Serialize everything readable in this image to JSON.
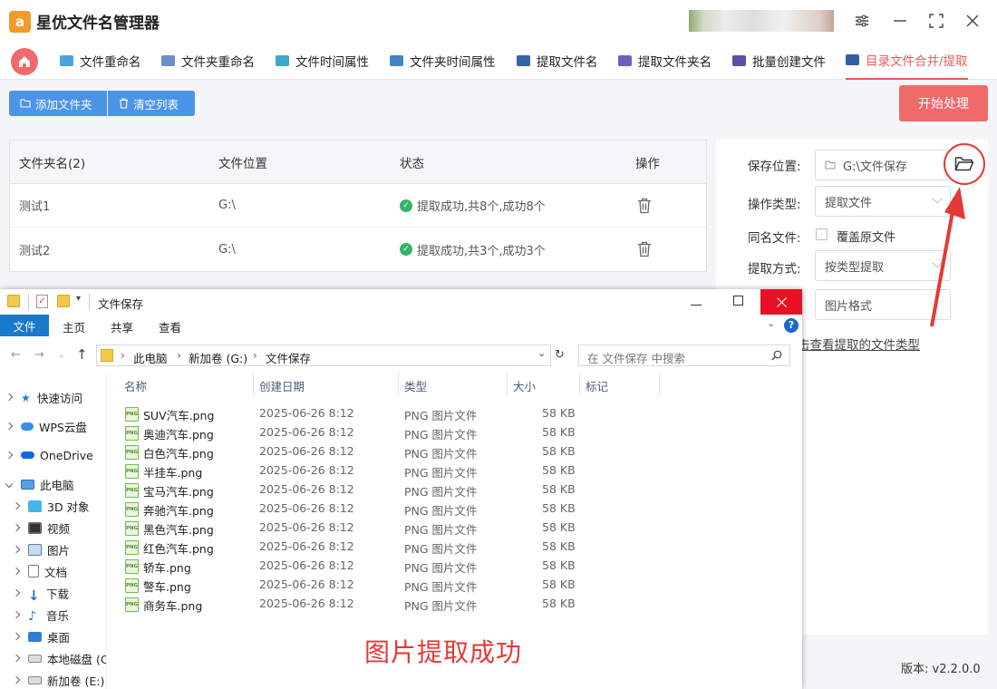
{
  "app": {
    "logo_text": "a",
    "title": "星优文件名管理器",
    "window_controls": [
      "settings-icon",
      "minimize-icon",
      "maximize-icon",
      "close-icon"
    ]
  },
  "tabs": [
    {
      "label": "文件重命名",
      "icon_color": "#4aa3df"
    },
    {
      "label": "文件夹重命名",
      "icon_color": "#6b8fc9"
    },
    {
      "label": "文件时间属性",
      "icon_color": "#3fa7c7"
    },
    {
      "label": "文件夹时间属性",
      "icon_color": "#3f87c7"
    },
    {
      "label": "提取文件名",
      "icon_color": "#3562a8"
    },
    {
      "label": "提取文件夹名",
      "icon_color": "#6a5fbf"
    },
    {
      "label": "批量创建文件",
      "icon_color": "#5c4fa8"
    },
    {
      "label": "目录文件合并/提取",
      "icon_color": "#2f5f9e",
      "active": true
    }
  ],
  "toolbar": {
    "add_folder": "添加文件夹",
    "clear_list": "清空列表",
    "start": "开始处理"
  },
  "table": {
    "headers": [
      "文件夹名(2)",
      "文件位置",
      "状态",
      "操作"
    ],
    "rows": [
      {
        "name": "测试1",
        "location": "G:\\",
        "status": "提取成功,共8个,成功8个"
      },
      {
        "name": "测试2",
        "location": "G:\\",
        "status": "提取成功,共3个,成功3个"
      }
    ]
  },
  "settings": {
    "save_location_label": "保存位置:",
    "save_location_value": "G:\\文件保存",
    "op_type_label": "操作类型:",
    "op_type_value": "提取文件",
    "same_name_label": "同名文件:",
    "overwrite_label": "覆盖原文件",
    "overwrite_checked": false,
    "extract_mode_label": "提取方式:",
    "extract_mode_value": "按类型提取",
    "format_value": "图片格式",
    "link_text": "击查看提取的文件类型"
  },
  "version": "版本: v2.2.0.0",
  "explorer": {
    "title": "文件保存",
    "ribbon": [
      "文件",
      "主页",
      "共享",
      "查看"
    ],
    "breadcrumb": [
      "此电脑",
      "新加卷 (G:)",
      "文件保存"
    ],
    "search_placeholder": "在 文件保存 中搜索",
    "sidebar": [
      {
        "label": "快速访问",
        "icon": "star-icon"
      },
      {
        "label": "WPS云盘",
        "icon": "cloud-icon"
      },
      {
        "label": "OneDrive",
        "icon": "onedrive-icon"
      },
      {
        "label": "此电脑",
        "icon": "computer-icon",
        "expanded": true
      },
      {
        "label": "3D 对象",
        "icon": "cube-icon"
      },
      {
        "label": "视频",
        "icon": "video-icon"
      },
      {
        "label": "图片",
        "icon": "picture-icon"
      },
      {
        "label": "文档",
        "icon": "document-icon"
      },
      {
        "label": "下载",
        "icon": "download-icon"
      },
      {
        "label": "音乐",
        "icon": "music-icon"
      },
      {
        "label": "桌面",
        "icon": "desktop-icon"
      },
      {
        "label": "本地磁盘 (C",
        "icon": "drive-icon"
      },
      {
        "label": "新加卷 (E:)",
        "icon": "drive-icon"
      }
    ],
    "columns": [
      "名称",
      "创建日期",
      "类型",
      "大小",
      "标记"
    ],
    "files": [
      {
        "name": "SUV汽车.png",
        "date": "2025-06-26 8:12",
        "type": "PNG 图片文件",
        "size": "58 KB"
      },
      {
        "name": "奥迪汽车.png",
        "date": "2025-06-26 8:12",
        "type": "PNG 图片文件",
        "size": "58 KB"
      },
      {
        "name": "白色汽车.png",
        "date": "2025-06-26 8:12",
        "type": "PNG 图片文件",
        "size": "58 KB"
      },
      {
        "name": "半挂车.png",
        "date": "2025-06-26 8:12",
        "type": "PNG 图片文件",
        "size": "58 KB"
      },
      {
        "name": "宝马汽车.png",
        "date": "2025-06-26 8:12",
        "type": "PNG 图片文件",
        "size": "58 KB"
      },
      {
        "name": "奔驰汽车.png",
        "date": "2025-06-26 8:12",
        "type": "PNG 图片文件",
        "size": "58 KB"
      },
      {
        "name": "黑色汽车.png",
        "date": "2025-06-26 8:12",
        "type": "PNG 图片文件",
        "size": "58 KB"
      },
      {
        "name": "红色汽车.png",
        "date": "2025-06-26 8:12",
        "type": "PNG 图片文件",
        "size": "58 KB"
      },
      {
        "name": "轿车.png",
        "date": "2025-06-26 8:12",
        "type": "PNG 图片文件",
        "size": "58 KB"
      },
      {
        "name": "警车.png",
        "date": "2025-06-26 8:12",
        "type": "PNG 图片文件",
        "size": "58 KB"
      },
      {
        "name": "商务车.png",
        "date": "2025-06-26 8:12",
        "type": "PNG 图片文件",
        "size": "58 KB"
      }
    ]
  },
  "annotation": {
    "success_text": "图片提取成功",
    "color": "#e53935"
  }
}
